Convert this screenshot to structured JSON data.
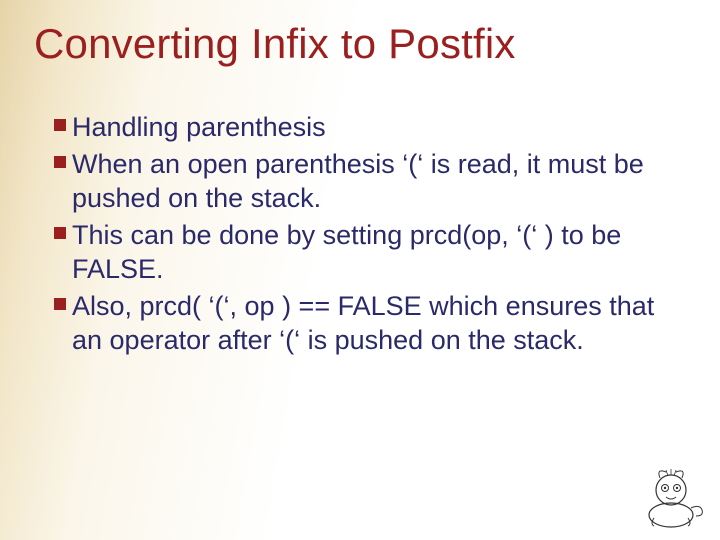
{
  "title": "Converting Infix to Postfix",
  "bullets": [
    "Handling parenthesis",
    "When an open parenthesis ‘(‘ is read, it must be pushed on the stack.",
    "This can be done by setting prcd(op, ‘(‘ ) to be FALSE.",
    "Also, prcd( ‘(‘, op ) == FALSE which ensures that an operator after ‘(‘ is pushed on the stack."
  ]
}
